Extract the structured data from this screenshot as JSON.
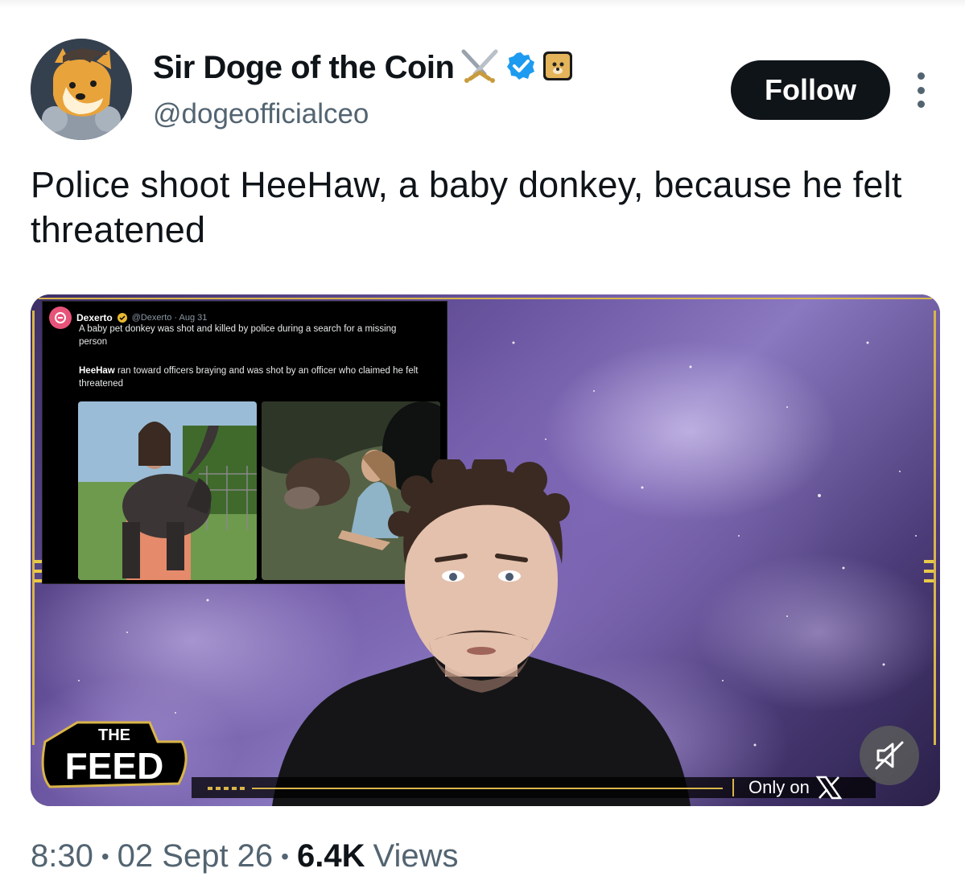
{
  "author": {
    "name": "Sir Doge of the Coin",
    "handle": "@dogeofficialceo",
    "avatar_icon": "doge-avatar-icon",
    "badges": [
      "crossed-swords-icon",
      "verified-checkmark-icon",
      "doge-badge-icon"
    ],
    "verified_color": "#1d9bf0"
  },
  "follow_label": "Follow",
  "more_icon": "more-vertical-icon",
  "tweet_text": "Police shoot HeeHaw, a baby donkey, because he felt threatened",
  "media": {
    "embedded_post": {
      "author": "Dexerto",
      "handle_date": "@Dexerto · Aug 31",
      "text_1": "A baby pet donkey was shot and killed by police during a search for a missing person",
      "text_2_bold": "HeeHaw",
      "text_2_rest": " ran toward officers braying and was shot by an officer who claimed he felt threatened"
    },
    "show_logo_top": "THE",
    "show_logo_bottom": "FEED",
    "only_on": "Only on",
    "platform_icon": "x-logo-icon",
    "mute_icon": "muted-speaker-icon"
  },
  "footer": {
    "time": "8:30",
    "date": "02 Sept 26",
    "views_count": "6.4K",
    "views_label": "Views"
  },
  "colors": {
    "accent_gold": "#d9b54a",
    "follow_bg": "#0f1419",
    "secondary_text": "#536471"
  }
}
